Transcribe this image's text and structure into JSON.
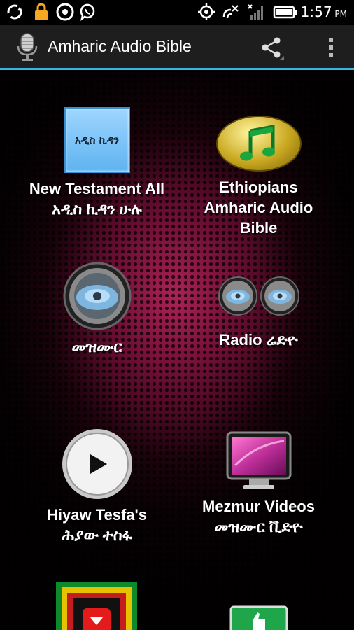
{
  "status_bar": {
    "time": "1:57",
    "ampm": "PM",
    "icons": [
      "sync-icon",
      "lock-icon",
      "chrome-icon",
      "viber-icon",
      "gps-icon",
      "wifi-call-icon",
      "signal-icon",
      "battery-icon"
    ]
  },
  "action_bar": {
    "title": "Amharic Audio Bible",
    "accent": "#33b5e5"
  },
  "tiles": [
    {
      "icon_text": "አዲስ ኪዳን",
      "line1": "New Testament All",
      "line2": "አዲስ ኪዳን ሁሉ"
    },
    {
      "line1": "Ethiopians",
      "line2": "Amharic Audio",
      "line3": "Bible"
    },
    {
      "line1": "መዝሙር"
    },
    {
      "line1": "Radio ሬድዮ"
    },
    {
      "line1": "Hiyaw Tesfa's",
      "line2": "ሕያው ተስፋ"
    },
    {
      "line1": "Mezmur Videos",
      "line2": "መዝሙር ቪድዮ"
    }
  ]
}
